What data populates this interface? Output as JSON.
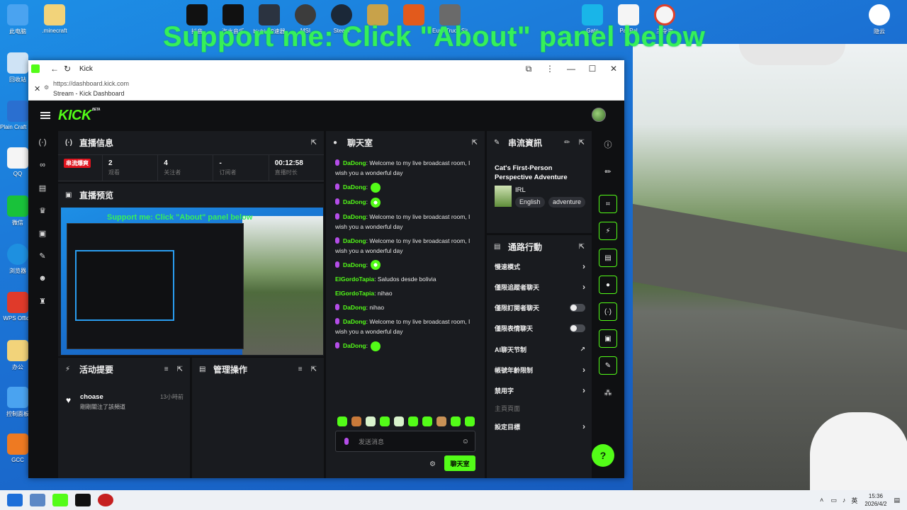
{
  "overlay": {
    "text": "Support me: Click \"About\" panel below"
  },
  "desktop_icons_left": [
    {
      "label": "此电脑",
      "color": "#4aa3f0"
    },
    {
      "label": "回收站",
      "color": "#cfe3f5"
    },
    {
      "label": "Plain Craft Launcher",
      "color": "#2a6fd0"
    },
    {
      "label": "QQ",
      "color": "#f5f5f5"
    },
    {
      "label": "微信",
      "color": "#19c23a"
    },
    {
      "label": "浏览器",
      "color": "#1e90e0"
    },
    {
      "label": "WPS Office",
      "color": "#e03a2a"
    },
    {
      "label": "办公",
      "color": "#f2d37a"
    },
    {
      "label": "控制面板",
      "color": "#4aa3f0"
    },
    {
      "label": "GCC",
      "color": "#ee7a22"
    }
  ],
  "desktop_icons_top": [
    {
      "label": ".minecraft",
      "color": "#f2d37a"
    },
    {
      "label": "抖音",
      "color": "#111111"
    },
    {
      "label": "汽水音乐",
      "color": "#111111"
    },
    {
      "label": "biubiu加速器",
      "color": "#2b3340"
    },
    {
      "label": "MSI",
      "color": "#3c3c3c"
    },
    {
      "label": "Steam",
      "color": "#1b2838"
    },
    {
      "label": "",
      "color": "#c8a24a"
    },
    {
      "label": "",
      "color": "#e25a1c"
    },
    {
      "label": "Euro Truck Simulator",
      "color": "#6a6a6a"
    },
    {
      "label": "Gate",
      "color": "#19b5e8"
    },
    {
      "label": "PayPal",
      "color": "#f5f5f5"
    },
    {
      "label": "三令资",
      "color": "#f5f5f5"
    },
    {
      "label": "隐云",
      "color": "#ffffff"
    }
  ],
  "browser": {
    "tab_title": "Kick",
    "url": "https://dashboard.kick.com",
    "page_title": "Stream - Kick Dashboard"
  },
  "app": {
    "logo": "KICK",
    "beta": "BETA"
  },
  "stream_info": {
    "title": "直播信息",
    "live_badge": "串流爆爽",
    "stats": [
      {
        "value": "2",
        "label": "观看"
      },
      {
        "value": "4",
        "label": "关注者"
      },
      {
        "value": "-",
        "label": "订阅者"
      },
      {
        "value": "00:12:58",
        "label": "直播时长"
      }
    ]
  },
  "preview": {
    "title": "直播预览",
    "overlay": "Support me: Click \"About\" panel below"
  },
  "chat": {
    "title": "聊天室",
    "messages": [
      {
        "user": "DaDong",
        "text": "Welcome to my live broadcast room, I wish you a wonderful day",
        "mic": true
      },
      {
        "user": "DaDong",
        "text": "",
        "mic": true,
        "emote": "plain"
      },
      {
        "user": "DaDong",
        "text": "",
        "mic": true,
        "emote": "dot"
      },
      {
        "user": "DaDong",
        "text": "Welcome to my live broadcast room, I wish you a wonderful day",
        "mic": true
      },
      {
        "user": "DaDong",
        "text": "Welcome to my live broadcast room, I wish you a wonderful day",
        "mic": true
      },
      {
        "user": "DaDong",
        "text": "",
        "mic": true,
        "emote": "dot"
      },
      {
        "user": "ElGordoTapia",
        "text": "Saludos desde bolivia",
        "mic": false
      },
      {
        "user": "ElGordoTapia",
        "text": "nihao",
        "mic": false
      },
      {
        "user": "DaDong",
        "text": "nihao",
        "mic": true
      },
      {
        "user": "DaDong",
        "text": "Welcome to my live broadcast room, I wish you a wonderful day",
        "mic": true
      },
      {
        "user": "DaDong",
        "text": "",
        "mic": true,
        "emote": "plain"
      }
    ],
    "input_placeholder": "发送消息",
    "send_label": "聊天室"
  },
  "stream_details": {
    "title": "串流資訊",
    "stream_title": "Cat's First-Person Perspective Adventure",
    "category": "IRL",
    "tags": [
      "English",
      "adventure"
    ]
  },
  "mod_actions": {
    "title": "通路行動",
    "rows": [
      {
        "label": "慢速模式",
        "type": "chevron"
      },
      {
        "label": "僅限追蹤者聊天",
        "type": "chevron"
      },
      {
        "label": "僅限訂閱者聊天",
        "type": "toggle"
      },
      {
        "label": "僅限表情聊天",
        "type": "toggle"
      },
      {
        "label": "AI聊天节制",
        "type": "external"
      },
      {
        "label": "帳號年齡限制",
        "type": "chevron"
      },
      {
        "label": "禁用字",
        "type": "chevron"
      },
      {
        "label": "主頁頁面",
        "type": "dim"
      },
      {
        "label": "設定目標",
        "type": "chevron"
      }
    ]
  },
  "activity": {
    "title": "活动提要",
    "items": [
      {
        "name": "choase",
        "desc": "剛剛關注了該頻道",
        "time": "13小時前"
      }
    ]
  },
  "moderation": {
    "title": "管理操作"
  },
  "taskbar": {
    "ime": "英",
    "time": "15:36",
    "date": "2026/4/2"
  }
}
